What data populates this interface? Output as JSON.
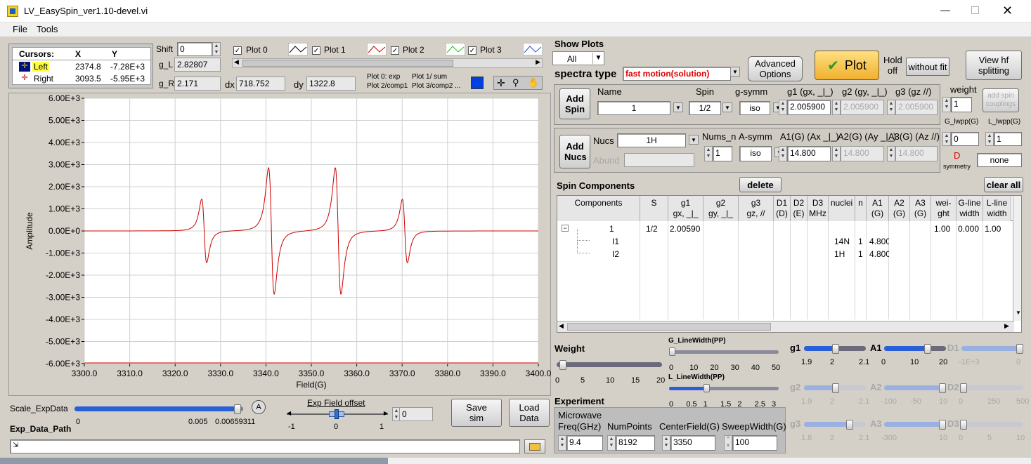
{
  "window": {
    "title": "LV_EasySpin_ver1.10-devel.vi"
  },
  "menu": [
    "File",
    "Tools"
  ],
  "cursors": {
    "header": [
      "Cursors:",
      "X",
      "Y"
    ],
    "rows": [
      {
        "name": "Left",
        "x": "2374.8",
        "y": "-7.28E+3"
      },
      {
        "name": "Right",
        "x": "3093.5",
        "y": "-5.95E+3"
      }
    ]
  },
  "shift": {
    "label": "Shift",
    "value": "0"
  },
  "g_L": {
    "label": "g_L",
    "value": "2.82807"
  },
  "g_R": {
    "label": "g_R",
    "value": "2.171"
  },
  "dx": {
    "label": "dx",
    "value": "718.752"
  },
  "dy": {
    "label": "dy",
    "value": "1322.8"
  },
  "plot_legend": [
    "Plot 0",
    "Plot 1",
    "Plot 2",
    "Plot 3"
  ],
  "plot_notes": [
    "Plot 0: exp",
    "Plot 1/ sum",
    "Plot 2/comp1",
    "Plot 3/comp2 ..."
  ],
  "chart_data": {
    "type": "line",
    "xlabel": "Field(G)",
    "ylabel": "Amplitude",
    "xlim": [
      3300,
      3400
    ],
    "ylim": [
      -6000,
      6000
    ],
    "x_ticks": [
      "3300.0",
      "3310.0",
      "3320.0",
      "3330.0",
      "3340.0",
      "3350.0",
      "3360.0",
      "3370.0",
      "3380.0",
      "3390.0",
      "3400.0"
    ],
    "y_ticks": [
      "6.00E+3",
      "5.00E+3",
      "4.00E+3",
      "3.00E+3",
      "2.00E+3",
      "1.00E+3",
      "0.00E+0",
      "-1.00E+3",
      "-2.00E+3",
      "-3.00E+3",
      "-4.00E+3",
      "-5.00E+3",
      "-6.00E+3"
    ],
    "grid": true,
    "series": [
      {
        "color": "#cc0000",
        "lines": [
          {
            "center": 3326.4,
            "half_width": 0.55,
            "amplitude": 2550
          },
          {
            "center": 3341.2,
            "half_width": 0.62,
            "amplitude": 5080
          },
          {
            "center": 3355.9,
            "half_width": 0.62,
            "amplitude": 5080
          },
          {
            "center": 3370.6,
            "half_width": 0.55,
            "amplitude": 2550
          }
        ]
      }
    ]
  },
  "scale_expdata": {
    "label": "Scale_ExpData",
    "ticks": [
      "0",
      "0.005",
      "0.00659311"
    ],
    "fraction": 0.98
  },
  "exp_field_offset": {
    "label": "Exp Field offset",
    "ticks": [
      "-1",
      "0",
      "1"
    ],
    "value": "0"
  },
  "exp_data_path": {
    "label": "Exp_Data_Path",
    "value": ""
  },
  "buttons": {
    "save": "Save sim",
    "load": "Load Data",
    "plot": "Plot",
    "hold": "Hold off",
    "without_fit": "without fit",
    "view_hf": "View hf splitting",
    "advanced": "Advanced Options",
    "add_spin": "Add Spin",
    "add_nucs": "Add Nucs",
    "delete": "delete",
    "clear_all": "clear all",
    "add_spin_couplings": "add spin couplings"
  },
  "show_plots": {
    "label": "Show Plots",
    "value": "All"
  },
  "spectra_type": {
    "label": "spectra type",
    "value": "fast motion(solution)"
  },
  "spin": {
    "name_label": "Name",
    "name": "1",
    "spin_label": "Spin",
    "spin": "1/2",
    "gsymm_label": "g-symm",
    "gsymm": "iso",
    "g1_label": "g1 (gx, _|_)",
    "g1": "2.005900",
    "g2_label": "g2 (gy, _|_)",
    "g2": "2.005900",
    "g3_label": "g3 (gz //)",
    "g3": "2.005900",
    "weight_label": "weight",
    "weight": "1"
  },
  "nucs": {
    "nucs_label": "Nucs",
    "nucs": "1H",
    "abund_label": "Abund",
    "abund": "",
    "nums_label": "Nums_n",
    "nums": "1",
    "asymm_label": "A-symm",
    "asymm": "iso",
    "a1_label": "A1(G) (Ax _|_)",
    "a1": "14.800",
    "a2_label": "A2(G) (Ay _|_)",
    "a2": "14.800",
    "a3_label": "A3(G) (Az //)",
    "a3": "14.800",
    "glw_label": "G_lwpp(G)",
    "glw": "0",
    "llw_label": "L_lwpp(G)",
    "llw": "1",
    "d_label": "D",
    "dsym_label": "symmetry",
    "dsym": "none"
  },
  "spin_components": {
    "title": "Spin Components",
    "headers": [
      [
        "Components"
      ],
      [
        "S"
      ],
      [
        "g1",
        "gx, _|_"
      ],
      [
        "g2",
        "gy, _|_"
      ],
      [
        "g3",
        "gz, //"
      ],
      [
        "D1",
        "(D)"
      ],
      [
        "D2",
        "(E)"
      ],
      [
        "D3",
        "MHz"
      ],
      [
        "nuclei"
      ],
      [
        "n"
      ],
      [
        "A1",
        "(G)"
      ],
      [
        "A2",
        "(G)"
      ],
      [
        "A3",
        "(G)"
      ],
      [
        "wei-",
        "ght"
      ],
      [
        "G-line",
        "width"
      ],
      [
        "L-line",
        "width"
      ]
    ],
    "rows": [
      {
        "comp": "1",
        "s": "1/2",
        "g1": "2.00590",
        "nuclei": "",
        "n": "",
        "a1": "",
        "weight": "1.00",
        "glw": "0.000",
        "llw": "1.00"
      },
      {
        "comp": "I1",
        "s": "",
        "g1": "",
        "nuclei": "14N",
        "n": "1",
        "a1": "4.800",
        "weight": "",
        "glw": "",
        "llw": ""
      },
      {
        "comp": "I2",
        "s": "",
        "g1": "",
        "nuclei": "1H",
        "n": "1",
        "a1": "4.800",
        "weight": "",
        "glw": "",
        "llw": ""
      }
    ]
  },
  "weight_slider": {
    "label": "Weight",
    "ticks": [
      "0",
      "5",
      "10",
      "15",
      "20"
    ],
    "fraction": 0.03
  },
  "g_linewidth": {
    "label": "G_LineWidth(PP)",
    "ticks": [
      "0",
      "10",
      "20",
      "30",
      "40",
      "50"
    ],
    "fraction": 0.0
  },
  "l_linewidth": {
    "label": "L_LineWidth(PP)",
    "ticks": [
      "0",
      "0.5",
      "1",
      "1.5",
      "2",
      "2.5",
      "3"
    ],
    "fraction": 0.33
  },
  "experiment": {
    "label": "Experiment",
    "mw_label": "Microwave Freq(GHz)",
    "mw": "9.4",
    "np_label": "NumPoints",
    "np": "8192",
    "cf_label": "CenterField(G)",
    "cf": "3350",
    "sw_label": "SweepWidth(G)",
    "sw": "100"
  },
  "param_sliders": [
    {
      "label": "g1",
      "ticks": [
        "1.9",
        "2",
        "2.1"
      ],
      "fraction": 0.52,
      "enabled": true
    },
    {
      "label": "A1",
      "ticks": [
        "0",
        "10",
        "20"
      ],
      "fraction": 0.74,
      "enabled": true
    },
    {
      "label": "D1",
      "ticks": [
        "-1E+3",
        "0"
      ],
      "fraction": 1.0,
      "enabled": false
    },
    {
      "label": "g2",
      "ticks": [
        "1.9",
        "2",
        "2.1"
      ],
      "fraction": 0.52,
      "enabled": false
    },
    {
      "label": "A2",
      "ticks": [
        "-100",
        "-50",
        "10"
      ],
      "fraction": 1.0,
      "enabled": false
    },
    {
      "label": "D2",
      "ticks": [
        "0",
        "250",
        "500"
      ],
      "fraction": 0.0,
      "enabled": false
    },
    {
      "label": "g3",
      "ticks": [
        "1.8",
        "2",
        "2.1"
      ],
      "fraction": 0.78,
      "enabled": false
    },
    {
      "label": "A3",
      "ticks": [
        "-300",
        "10"
      ],
      "fraction": 1.0,
      "enabled": false
    },
    {
      "label": "D3",
      "ticks": [
        "0",
        "5",
        "10"
      ],
      "fraction": 0.0,
      "enabled": false
    }
  ]
}
